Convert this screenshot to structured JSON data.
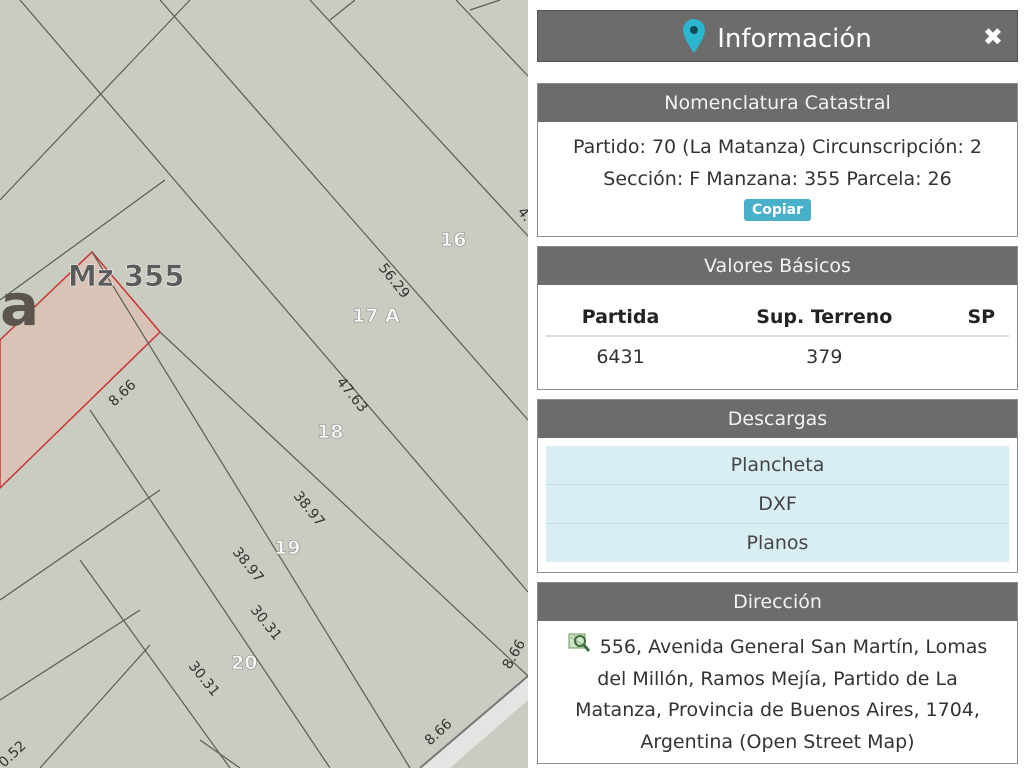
{
  "map": {
    "block_label": "Mz 355",
    "partial_label": "a",
    "parcel_numbers": [
      "16",
      "17 A",
      "18",
      "19",
      "20"
    ],
    "measurements": [
      "56.29",
      "47.63",
      "38.97",
      "38.97",
      "30.31",
      "30.31",
      "8.66",
      "8.66",
      "8.66",
      "4.",
      "0.52"
    ]
  },
  "panel": {
    "title": "Información",
    "close_symbol": "✖",
    "nomenclatura": {
      "header": "Nomenclatura Catastral",
      "line1": "Partido: 70 (La Matanza) Circunscripción: 2",
      "line2": "Sección: F Manzana: 355 Parcela: 26",
      "copy_label": "Copiar"
    },
    "valores": {
      "header": "Valores Básicos",
      "columns": [
        "Partida",
        "Sup. Terreno",
        "SP"
      ],
      "row": [
        "6431",
        "379",
        ""
      ]
    },
    "descargas": {
      "header": "Descargas",
      "items": [
        "Plancheta",
        "DXF",
        "Planos"
      ]
    },
    "direccion": {
      "header": "Dirección",
      "text": "556, Avenida General San Martín, Lomas del Millón, Ramos Mejía, Partido de La Matanza, Provincia de Buenos Aires, 1704, Argentina (Open Street Map)"
    }
  },
  "colors": {
    "header_bg": "#6b6c6b",
    "accent": "#48b0c8",
    "map_bg": "#c9ccc0",
    "parcel_highlight": "#cc3333"
  },
  "icons": [
    "location-pin-icon",
    "close-icon",
    "map-search-icon"
  ]
}
